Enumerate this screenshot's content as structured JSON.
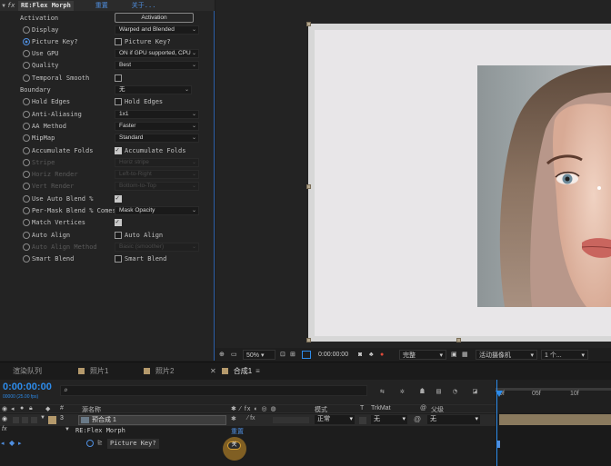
{
  "effect": {
    "name": "RE:Flex Morph",
    "reset_label": "重置",
    "about_label": "关于...",
    "fx_label": "fx",
    "activation": {
      "label": "Activation",
      "button": "Activation"
    },
    "params": [
      {
        "label": "Display",
        "control": "select",
        "value": "Warped and Blended"
      },
      {
        "label": "Picture Key?",
        "control": "checkbox",
        "checked": false,
        "cb_label": "Picture Key?",
        "keyframed": true
      },
      {
        "label": "Use GPU",
        "control": "select",
        "value": "ON if GPU supported, CPU"
      },
      {
        "label": "Quality",
        "control": "select",
        "value": "Best"
      },
      {
        "label": "Temporal Smooth",
        "control": "checkbox",
        "checked": false,
        "cb_label": ""
      },
      {
        "label": "Boundary",
        "control": "select",
        "value": "无",
        "nostop": true
      },
      {
        "label": "Hold Edges",
        "control": "checkbox",
        "checked": false,
        "cb_label": "Hold Edges"
      },
      {
        "label": "Anti-Aliasing",
        "control": "select",
        "value": "1x1"
      },
      {
        "label": "AA Method",
        "control": "select",
        "value": "Faster"
      },
      {
        "label": "MipMap",
        "control": "select",
        "value": "Standard"
      },
      {
        "label": "Accumulate Folds",
        "control": "checkbox",
        "checked": true,
        "cb_label": "Accumulate Folds"
      },
      {
        "label": "Stripe",
        "control": "select",
        "value": "Horiz stripe",
        "dim": true
      },
      {
        "label": "Horiz Render",
        "control": "select",
        "value": "Left-to-Right",
        "dim": true
      },
      {
        "label": "Vert Render",
        "control": "select",
        "value": "Bottom-to-Top",
        "dim": true
      },
      {
        "label": "Use Auto Blend %",
        "control": "checkbox",
        "checked": true,
        "cb_label": ""
      },
      {
        "label": "Per-Mask Blend % Comes",
        "control": "select",
        "value": "Mask Opacity"
      },
      {
        "label": "Match Vertices",
        "control": "checkbox",
        "checked": true,
        "cb_label": ""
      },
      {
        "label": "Auto Align",
        "control": "checkbox",
        "checked": false,
        "cb_label": "Auto Align"
      },
      {
        "label": "Auto Align Method",
        "control": "select",
        "value": "Basic (smoother)",
        "dim": true
      },
      {
        "label": "Smart Blend",
        "control": "checkbox",
        "checked": false,
        "cb_label": "Smart Blend"
      }
    ]
  },
  "viewer": {
    "zoom": "50%",
    "timecode": "0:00:00:00",
    "resolution": "完整",
    "camera": "活动摄像机",
    "views": "1 个..."
  },
  "tabs": [
    {
      "label": "渲染队列",
      "swatch": false
    },
    {
      "label": "照片1",
      "swatch": true
    },
    {
      "label": "照片2",
      "swatch": true
    },
    {
      "label": "合成1",
      "swatch": true,
      "active": true
    }
  ],
  "timeline": {
    "timecode": "0:00:00:00",
    "timecode_sub": "00000 (25.00 fps)",
    "search_placeholder": "",
    "columns": {
      "num": "#",
      "source": "源名称",
      "mode": "模式",
      "t": "T",
      "trkmat": "TrkMat",
      "parent": "父级"
    },
    "ruler": [
      "0f",
      "05f",
      "10f"
    ],
    "layer": {
      "num": "3",
      "name": "预合成 1",
      "mode": "正常",
      "trkmat": "无",
      "parent": "无"
    },
    "effect_row": {
      "name": "RE:Flex Morph",
      "reset": "重置"
    },
    "param_row": {
      "name": "Picture Key?",
      "value": "关"
    }
  },
  "colors": {
    "accent": "#2d8ceb",
    "label_tan": "#b59a6c"
  }
}
